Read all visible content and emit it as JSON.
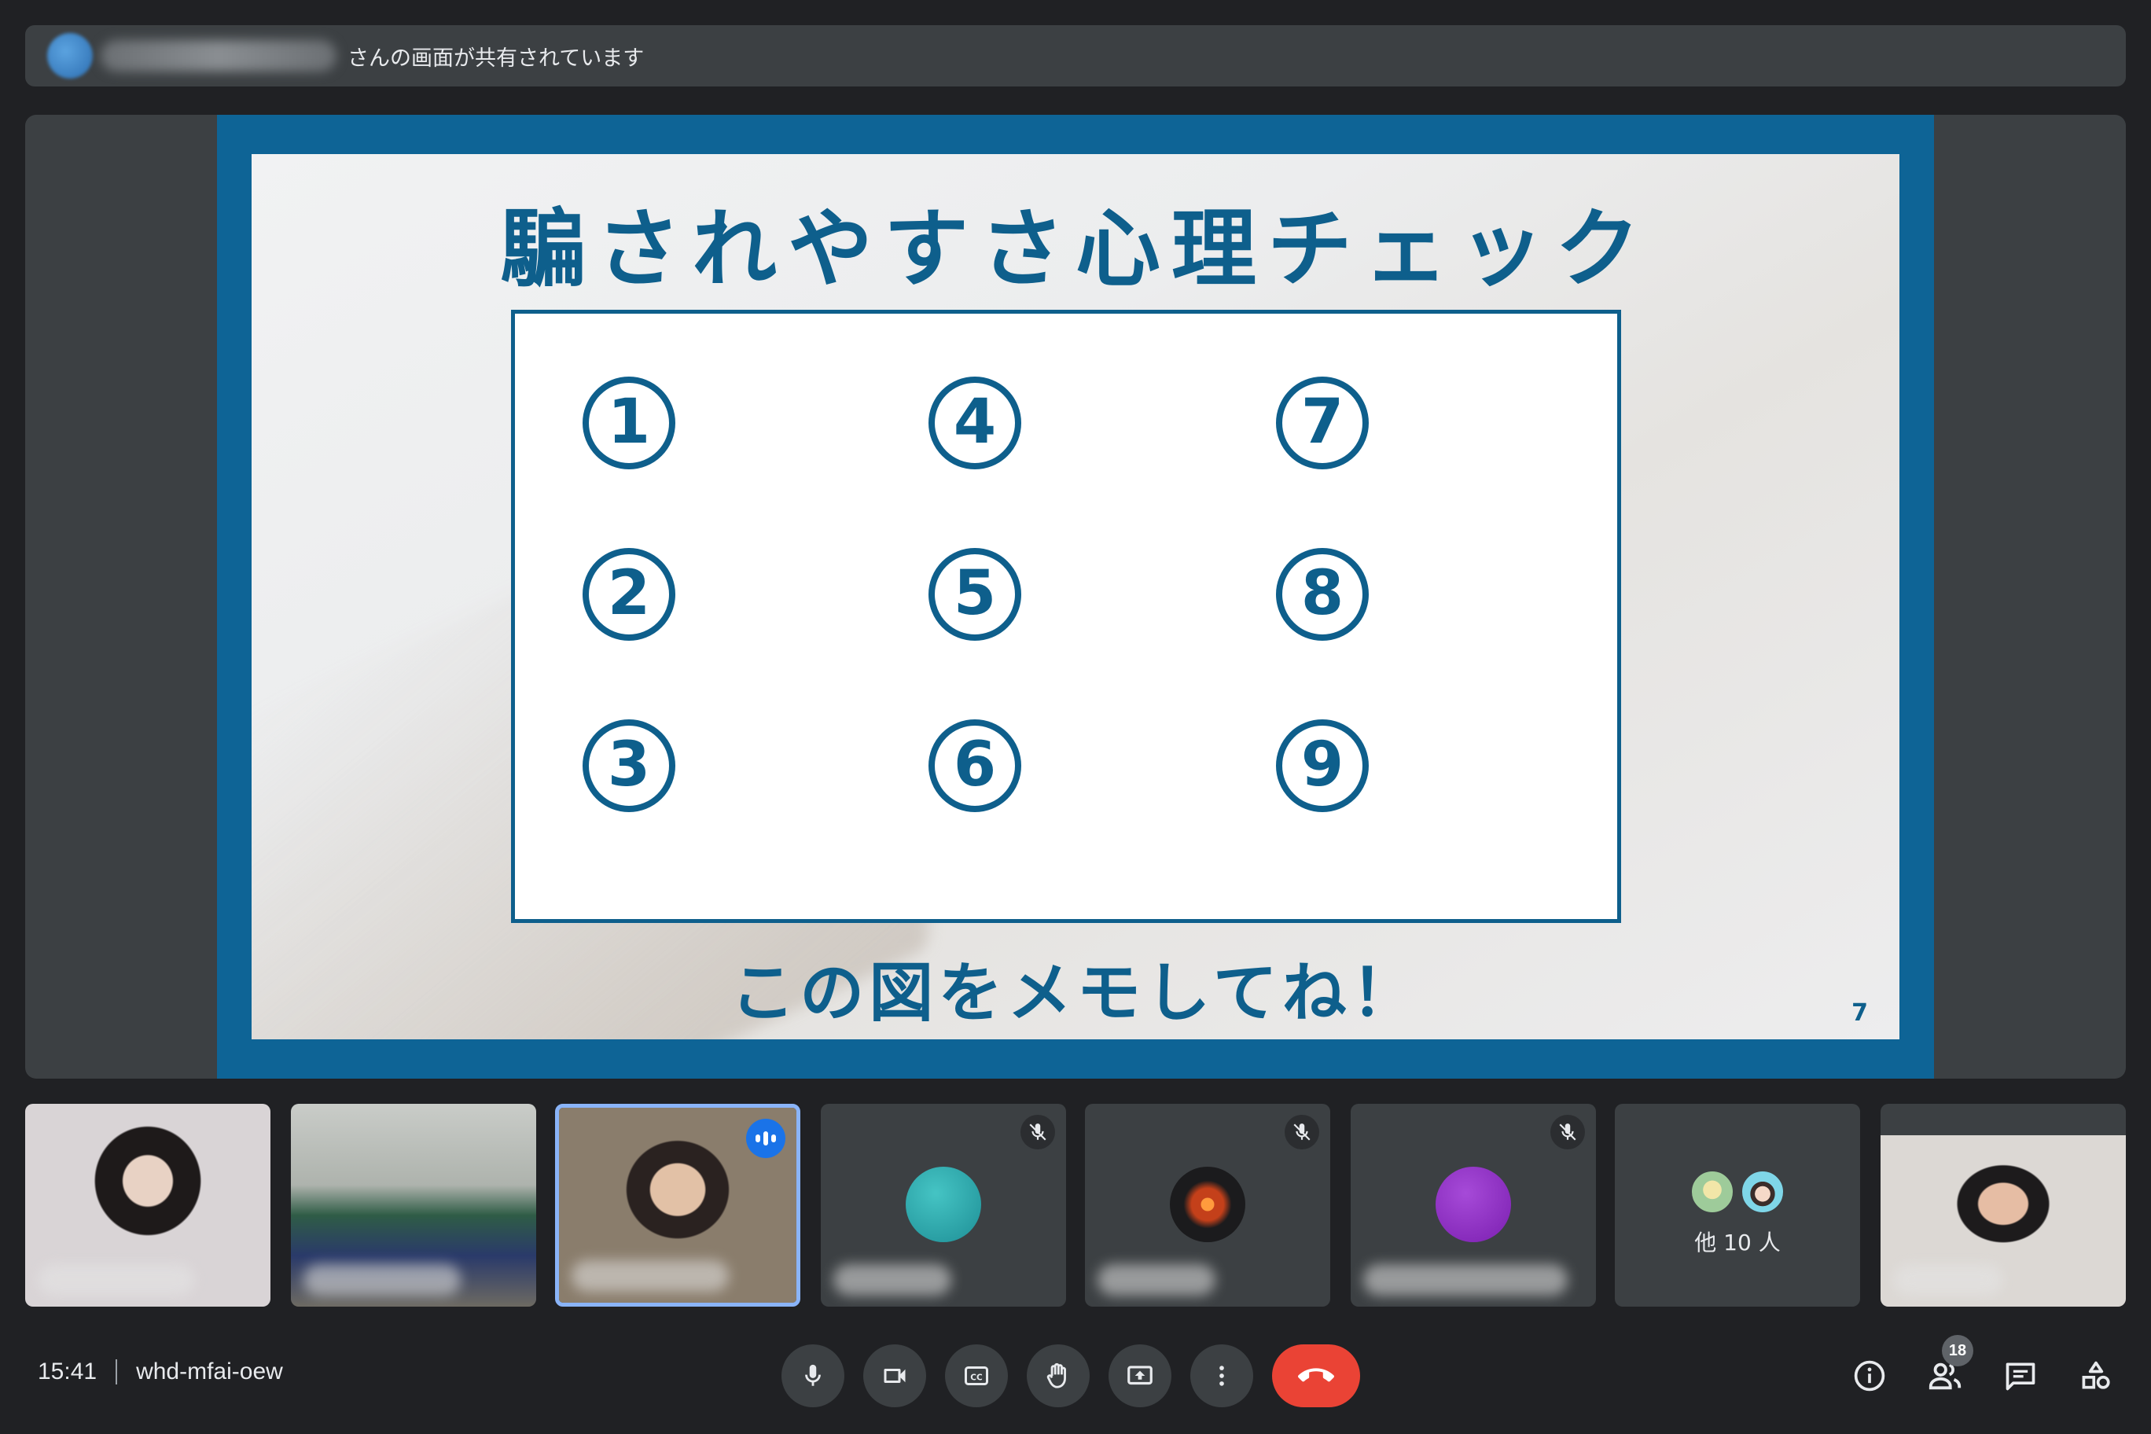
{
  "banner": {
    "share_text": "さんの画面が共有されています"
  },
  "slide": {
    "title": "騙されやすさ心理チェック",
    "numbers": [
      "1",
      "4",
      "7",
      "2",
      "5",
      "8",
      "3",
      "6",
      "9"
    ],
    "subtitle": "この図をメモしてね！",
    "page_number": "7"
  },
  "tiles": {
    "others_label": "他 10 人"
  },
  "bottom": {
    "time": "15:41",
    "meeting_code": "whd-mfai-oew",
    "participants_count": "18"
  },
  "icons": {
    "mic": "microphone-icon",
    "camera": "camera-icon",
    "captions": "captions-icon",
    "hand": "raise-hand-icon",
    "present": "present-screen-icon",
    "more": "more-options-icon",
    "end": "end-call-icon",
    "info": "info-icon",
    "people": "people-icon",
    "chat": "chat-icon",
    "activities": "activities-icon"
  },
  "colors": {
    "slide_blue": "#0e5f8c",
    "end_call": "#ea4335",
    "speaking": "#1a73e8"
  }
}
